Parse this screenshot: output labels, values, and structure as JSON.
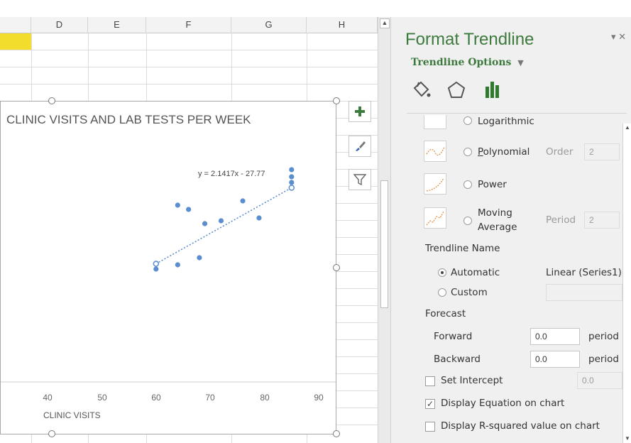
{
  "sheet": {
    "columns": [
      "D",
      "E",
      "F",
      "G",
      "H"
    ]
  },
  "chart": {
    "title": "CLINIC VISITS AND LAB TESTS PER WEEK",
    "equation": "y = 2.1417x - 27.77",
    "add_element_icon": "plus-icon",
    "styles_icon": "brush-icon",
    "filters_icon": "funnel-icon"
  },
  "chart_data": {
    "type": "scatter",
    "title": "CLINIC VISITS AND LAB TESTS PER WEEK",
    "xlabel": "CLINIC VISITS",
    "ylabel": "",
    "x_ticks": [
      "40",
      "50",
      "60",
      "70",
      "80",
      "90"
    ],
    "xlim": [
      35,
      90
    ],
    "ylim": [
      80,
      180
    ],
    "points": [
      {
        "x": 60,
        "y": 97
      },
      {
        "x": 64,
        "y": 100
      },
      {
        "x": 64,
        "y": 142
      },
      {
        "x": 66,
        "y": 139
      },
      {
        "x": 68,
        "y": 105
      },
      {
        "x": 69,
        "y": 129
      },
      {
        "x": 72,
        "y": 131
      },
      {
        "x": 76,
        "y": 145
      },
      {
        "x": 79,
        "y": 133
      },
      {
        "x": 85,
        "y": 158
      },
      {
        "x": 85,
        "y": 167
      },
      {
        "x": 85,
        "y": 162
      }
    ],
    "trendline": {
      "type": "linear",
      "slope": 2.1417,
      "intercept": -27.77,
      "x_range": [
        60,
        85
      ],
      "style": "dotted"
    },
    "series_color": "#5b8ecf",
    "grid": false
  },
  "pane": {
    "title": "Format Trendline",
    "close_glyph": "▾ ✕",
    "options_label": "Trendline Options",
    "tabs": [
      "fill-line-icon",
      "effects-icon",
      "trendline-options-icon"
    ],
    "logarithmic_label": "Logarithmic",
    "polynomial_label": "Polynomial",
    "order_label": "Order",
    "order_value": "2",
    "power_label": "Power",
    "moving_label_1": "Moving",
    "moving_label_2": "Average",
    "period_label": "Period",
    "period_value": "2",
    "name_section": "Trendline Name",
    "automatic_label": "Automatic",
    "automatic_value": "Linear (Series1)",
    "custom_label": "Custom",
    "forecast_section": "Forecast",
    "forward_label": "Forward",
    "forward_value": "0.0",
    "forward_unit": "period",
    "backward_label": "Backward",
    "backward_value": "0.0",
    "backward_unit": "period",
    "intercept_label": "Set Intercept",
    "intercept_value": "0.0",
    "display_eq_label": "Display Equation on chart",
    "display_eq_checked": true,
    "display_r2_label": "Display R-squared value on chart",
    "display_r2_checked": false
  },
  "colors": {
    "accent": "#3d7a3d",
    "marker": "#5b8ecf",
    "highlight_cell": "#f2dd2c"
  }
}
